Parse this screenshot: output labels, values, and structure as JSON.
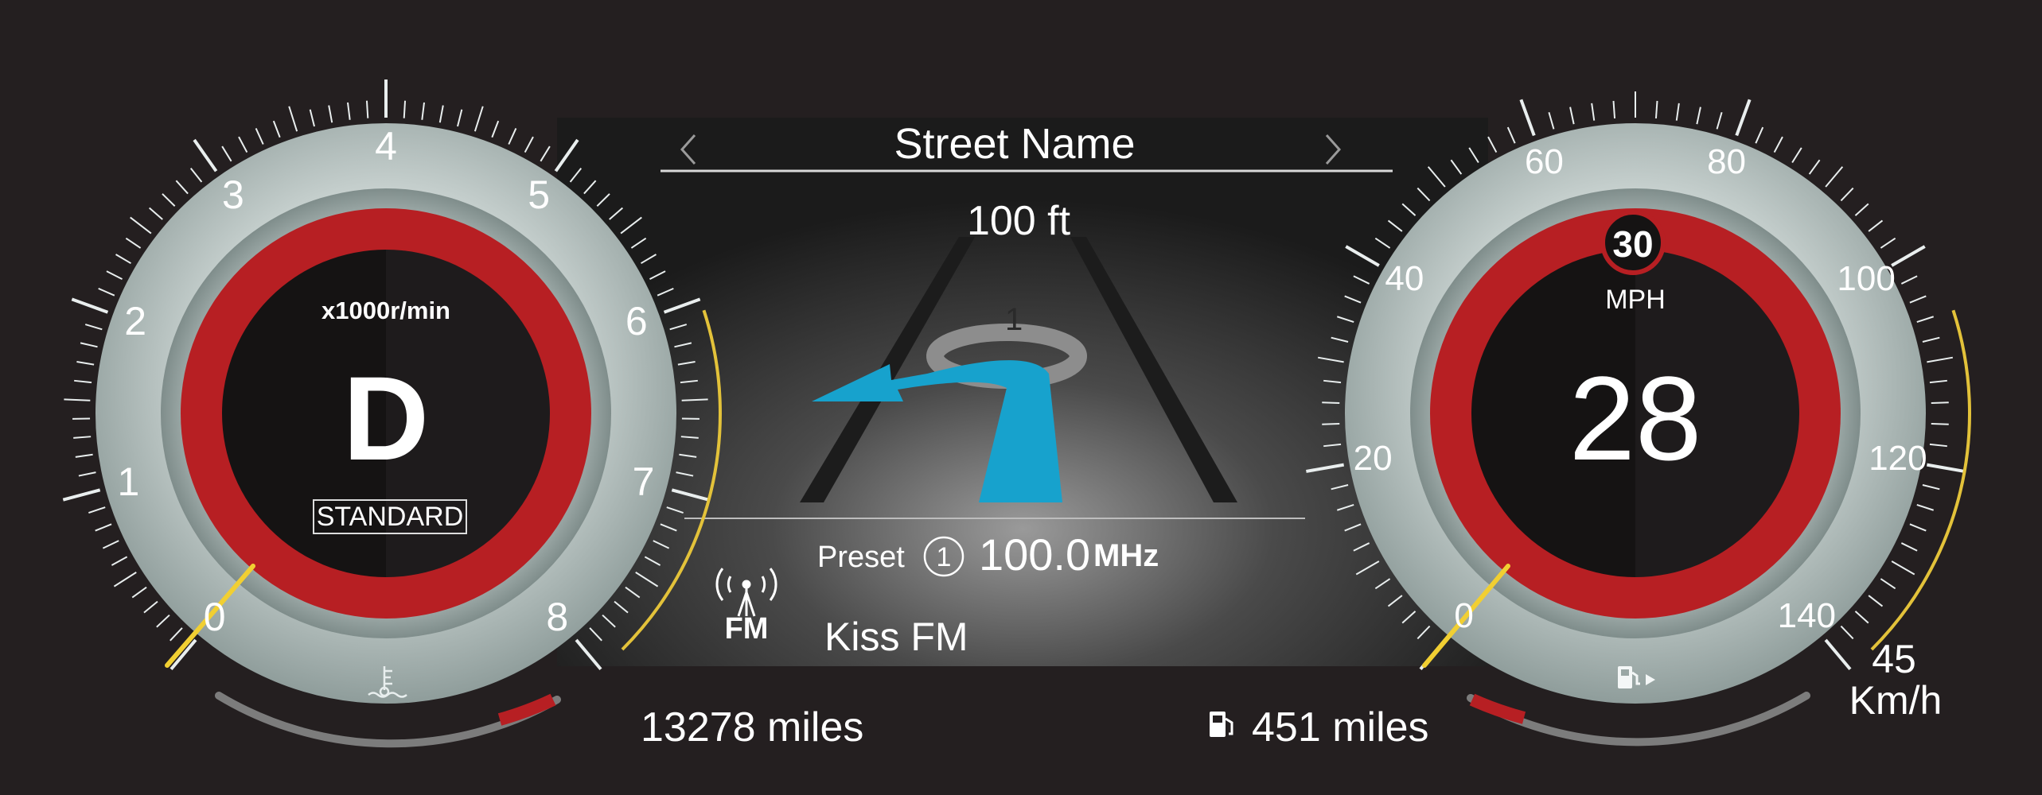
{
  "tachometer": {
    "unit_label": "x1000r/min",
    "gear": "D",
    "drive_mode": "STANDARD",
    "rpm_labels": [
      "0",
      "1",
      "2",
      "3",
      "4",
      "5",
      "6",
      "7",
      "8"
    ],
    "rpm_value": 0
  },
  "speedometer": {
    "speed_limit": "30",
    "unit": "MPH",
    "speed": "28",
    "speed_labels": [
      "0",
      "20",
      "40",
      "60",
      "80",
      "100",
      "120",
      "140"
    ],
    "kmh_value": "45",
    "kmh_unit": "Km/h"
  },
  "navigation": {
    "street_name": "Street Name",
    "distance": "100 ft",
    "roundabout_exit": "1"
  },
  "radio": {
    "band": "FM",
    "preset_label": "Preset",
    "preset_number": "1",
    "frequency": "100.0",
    "frequency_unit": "MHz",
    "station": "Kiss FM"
  },
  "trip": {
    "odometer": "13278 miles",
    "range": "451 miles"
  },
  "colors": {
    "background": "#241f20",
    "gauge_ring": "#bcc6c4",
    "red_ring": "#b71f23",
    "needle": "#f1cf32",
    "nav_arrow": "#17a2cd"
  }
}
